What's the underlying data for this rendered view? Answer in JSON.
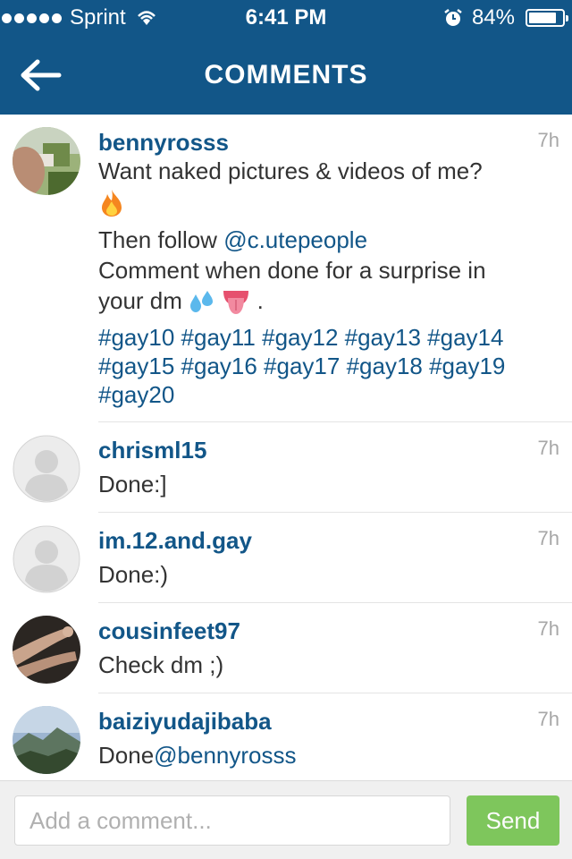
{
  "status_bar": {
    "carrier": "Sprint",
    "time": "6:41 PM",
    "battery": "84%",
    "battery_level": 0.84,
    "icons": [
      "signal-dots-icon",
      "wifi-icon",
      "alarm-icon",
      "battery-icon"
    ]
  },
  "nav": {
    "title": "COMMENTS",
    "back_icon": "back-arrow-icon"
  },
  "comments": [
    {
      "username": "bennyrosss",
      "time": "7h",
      "line1": "Want naked pictures & videos of me?",
      "line2_prefix": "Then follow ",
      "line2_mention": "@c.utepeople",
      "line3": "Comment when done for a surprise in your dm",
      "line3_suffix": " .",
      "emojis": [
        "fire-emoji",
        "sweat-droplets-emoji",
        "tongue-emoji"
      ],
      "tags": "#gay10 #gay11 #gay12 #gay13 #gay14 #gay15 #gay16 #gay17 #gay18 #gay19 #gay20"
    },
    {
      "username": "chrisml15",
      "time": "7h",
      "text": "Done:]"
    },
    {
      "username": "im.12.and.gay",
      "time": "7h",
      "text": "Done:)"
    },
    {
      "username": "cousinfeet97",
      "time": "7h",
      "text": "Check dm ;)"
    },
    {
      "username": "baiziyudajibaba",
      "time": "7h",
      "text_prefix": "Done",
      "mention": "@bennyrosss"
    }
  ],
  "composer": {
    "placeholder": "Add a comment...",
    "send_label": "Send"
  },
  "colors": {
    "brand": "#125688",
    "send": "#6bbf43",
    "timestamp": "#a7a7a7"
  }
}
